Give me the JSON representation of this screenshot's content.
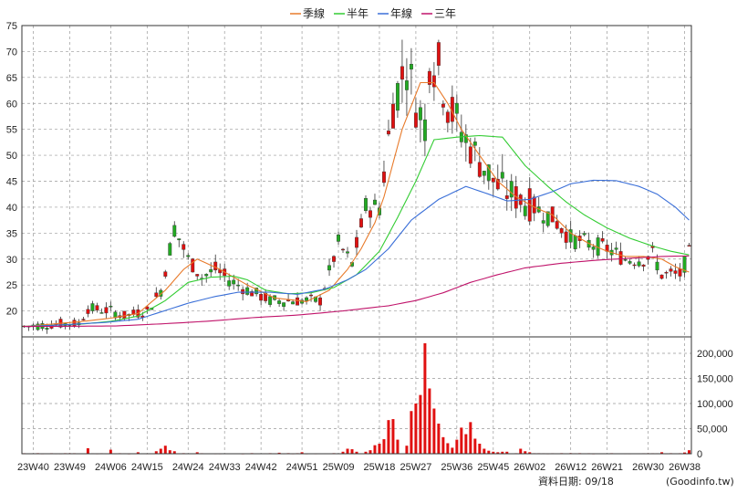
{
  "chart_data": {
    "type": "candlestick",
    "legend": [
      {
        "name": "季線",
        "color": "#e87a2a"
      },
      {
        "name": "半年",
        "color": "#33cc33"
      },
      {
        "name": "年線",
        "color": "#3a6fd8"
      },
      {
        "name": "三年",
        "color": "#c0136a"
      }
    ],
    "price_axis": {
      "min": 15,
      "max": 75,
      "ticks": [
        20,
        25,
        30,
        35,
        40,
        45,
        50,
        55,
        60,
        65,
        70,
        75
      ]
    },
    "volume_axis": {
      "min": 0,
      "max": 220000,
      "ticks": [
        0,
        50000,
        100000,
        150000,
        200000
      ],
      "tick_labels": [
        "0",
        "50,000",
        "100,000",
        "150,000",
        "200,000"
      ]
    },
    "x_ticks": [
      "23W40",
      "23W49",
      "24W06",
      "24W15",
      "24W24",
      "24W33",
      "24W42",
      "24W51",
      "25W09",
      "25W18",
      "25W27",
      "25W36",
      "25W45",
      "26W02",
      "26W12",
      "26W21",
      "26W30",
      "26W38"
    ],
    "footer": {
      "date_label": "資料日期: 09/18",
      "source": "(Goodinfo.tw)"
    },
    "colors": {
      "up": "#e01010",
      "down": "#22aa22",
      "grid": "#999999",
      "volume": "#e01010"
    },
    "price_anchors": [
      [
        0,
        17
      ],
      [
        8,
        17.5
      ],
      [
        12,
        17.5
      ],
      [
        14,
        20.5
      ],
      [
        19,
        20
      ],
      [
        22,
        19
      ],
      [
        27,
        20
      ],
      [
        30,
        24
      ],
      [
        33,
        36
      ],
      [
        36,
        30
      ],
      [
        39,
        26.5
      ],
      [
        42,
        28
      ],
      [
        45,
        26
      ],
      [
        48,
        24.5
      ],
      [
        54,
        22
      ],
      [
        62,
        22
      ],
      [
        65,
        22
      ],
      [
        69,
        33
      ],
      [
        72,
        29
      ],
      [
        75,
        40
      ],
      [
        78,
        40
      ],
      [
        81,
        60
      ],
      [
        84,
        68
      ],
      [
        86,
        60
      ],
      [
        88,
        56
      ],
      [
        89,
        69
      ],
      [
        91,
        67
      ],
      [
        93,
        60
      ],
      [
        97,
        53
      ],
      [
        100,
        49
      ],
      [
        104,
        44
      ],
      [
        108,
        42
      ],
      [
        112,
        40
      ],
      [
        116,
        38
      ],
      [
        120,
        34
      ],
      [
        124,
        33
      ],
      [
        128,
        32
      ],
      [
        132,
        30
      ],
      [
        136,
        30
      ],
      [
        138,
        31
      ],
      [
        140,
        27
      ],
      [
        144,
        27
      ],
      [
        146,
        31
      ]
    ],
    "ma_quarter": [
      [
        0,
        17
      ],
      [
        13,
        18
      ],
      [
        19,
        18.6
      ],
      [
        25,
        19.5
      ],
      [
        31,
        24
      ],
      [
        35,
        28
      ],
      [
        38,
        30
      ],
      [
        43,
        28
      ],
      [
        49,
        25
      ],
      [
        55,
        22.5
      ],
      [
        62,
        21.8
      ],
      [
        67,
        24
      ],
      [
        71,
        28
      ],
      [
        74,
        32
      ],
      [
        77,
        37
      ],
      [
        79,
        42
      ],
      [
        83,
        55
      ],
      [
        87,
        64
      ],
      [
        90,
        64
      ],
      [
        93,
        60
      ],
      [
        96,
        55
      ],
      [
        100,
        50
      ],
      [
        104,
        45
      ],
      [
        108,
        42
      ],
      [
        112,
        40
      ],
      [
        116,
        38.5
      ],
      [
        120,
        35
      ],
      [
        124,
        33
      ],
      [
        128,
        31.5
      ],
      [
        132,
        30.5
      ],
      [
        136,
        30.5
      ],
      [
        140,
        30
      ],
      [
        143,
        28.5
      ],
      [
        146,
        27.5
      ]
    ],
    "ma_half": [
      [
        0,
        17
      ],
      [
        13,
        17.5
      ],
      [
        19,
        18
      ],
      [
        25,
        19
      ],
      [
        31,
        22
      ],
      [
        36,
        25.5
      ],
      [
        41,
        26.5
      ],
      [
        46,
        26.7
      ],
      [
        49,
        26
      ],
      [
        53,
        24
      ],
      [
        58,
        23.3
      ],
      [
        63,
        23.5
      ],
      [
        68,
        24.5
      ],
      [
        73,
        27
      ],
      [
        78,
        31.5
      ],
      [
        82,
        38
      ],
      [
        86,
        45
      ],
      [
        90,
        53
      ],
      [
        95,
        53.5
      ],
      [
        100,
        53.8
      ],
      [
        105,
        53.5
      ],
      [
        110,
        48
      ],
      [
        115,
        44
      ],
      [
        119,
        41
      ],
      [
        123,
        38.5
      ],
      [
        128,
        36
      ],
      [
        133,
        34
      ],
      [
        138,
        32.5
      ],
      [
        142,
        31.5
      ],
      [
        146,
        30.8
      ]
    ],
    "ma_year": [
      [
        0,
        17
      ],
      [
        8,
        17.3
      ],
      [
        18,
        17.8
      ],
      [
        25,
        18.4
      ],
      [
        30,
        19.8
      ],
      [
        36,
        21.5
      ],
      [
        42,
        22.8
      ],
      [
        47,
        23.6
      ],
      [
        54,
        23.6
      ],
      [
        60,
        23.2
      ],
      [
        66,
        24.2
      ],
      [
        71,
        26
      ],
      [
        75,
        28
      ],
      [
        80,
        32
      ],
      [
        85,
        37.5
      ],
      [
        91,
        41.5
      ],
      [
        97,
        44
      ],
      [
        102,
        42.5
      ],
      [
        106,
        41.2
      ],
      [
        111,
        41.5
      ],
      [
        116,
        43
      ],
      [
        120,
        44.5
      ],
      [
        125,
        45.2
      ],
      [
        130,
        45.1
      ],
      [
        135,
        44
      ],
      [
        139,
        42.5
      ],
      [
        143,
        40
      ],
      [
        146,
        37.5
      ]
    ],
    "ma_3yr": [
      [
        0,
        17
      ],
      [
        20,
        17.1
      ],
      [
        30,
        17.5
      ],
      [
        40,
        18
      ],
      [
        50,
        18.7
      ],
      [
        60,
        19.2
      ],
      [
        70,
        20
      ],
      [
        80,
        21
      ],
      [
        86,
        22
      ],
      [
        92,
        23.5
      ],
      [
        98,
        25.5
      ],
      [
        104,
        27
      ],
      [
        110,
        28.3
      ],
      [
        118,
        29.2
      ],
      [
        126,
        29.8
      ],
      [
        134,
        30.2
      ],
      [
        140,
        30.5
      ],
      [
        146,
        30.6
      ]
    ],
    "volume_spikes": [
      [
        14,
        11000
      ],
      [
        19,
        8000
      ],
      [
        25,
        3000
      ],
      [
        29,
        5000
      ],
      [
        30,
        10000
      ],
      [
        31,
        16000
      ],
      [
        32,
        7000
      ],
      [
        33,
        5000
      ],
      [
        38,
        3000
      ],
      [
        56,
        2000
      ],
      [
        61,
        3000
      ],
      [
        70,
        4000
      ],
      [
        71,
        10000
      ],
      [
        72,
        9000
      ],
      [
        73,
        4000
      ],
      [
        75,
        4000
      ],
      [
        76,
        7000
      ],
      [
        77,
        17000
      ],
      [
        78,
        20000
      ],
      [
        79,
        29000
      ],
      [
        80,
        67000
      ],
      [
        81,
        69000
      ],
      [
        82,
        28000
      ],
      [
        84,
        16000
      ],
      [
        85,
        85000
      ],
      [
        86,
        100000
      ],
      [
        87,
        117000
      ],
      [
        88,
        220000
      ],
      [
        89,
        130000
      ],
      [
        90,
        90000
      ],
      [
        91,
        60000
      ],
      [
        92,
        33000
      ],
      [
        93,
        21000
      ],
      [
        94,
        12000
      ],
      [
        95,
        28000
      ],
      [
        96,
        52000
      ],
      [
        97,
        39000
      ],
      [
        98,
        63000
      ],
      [
        99,
        30000
      ],
      [
        100,
        20000
      ],
      [
        101,
        10000
      ],
      [
        102,
        6000
      ],
      [
        103,
        4000
      ],
      [
        104,
        3000
      ],
      [
        105,
        4000
      ],
      [
        106,
        4000
      ],
      [
        109,
        10000
      ],
      [
        110,
        5000
      ],
      [
        111,
        3000
      ],
      [
        140,
        3000
      ],
      [
        145,
        2500
      ],
      [
        146,
        7000
      ]
    ]
  }
}
